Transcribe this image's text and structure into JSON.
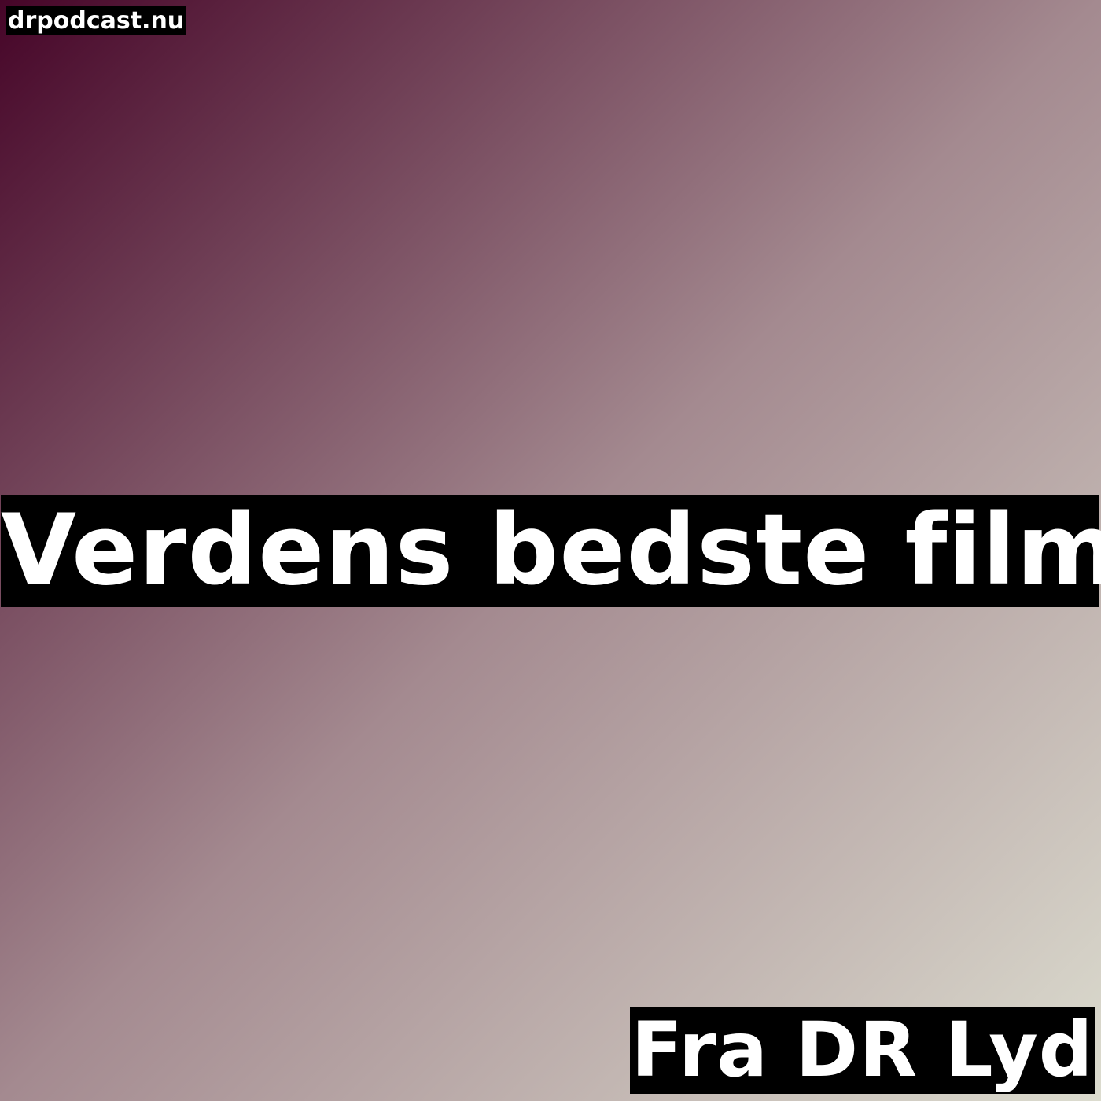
{
  "site": "drpodcast.nu",
  "title": "Verdens bedste film",
  "source": "Fra DR Lyd",
  "colors": {
    "gradient_start": "#460528",
    "gradient_mid": "#a48a90",
    "gradient_end": "#dcdccf",
    "label_background": "#000000",
    "text": "#ffffff"
  }
}
